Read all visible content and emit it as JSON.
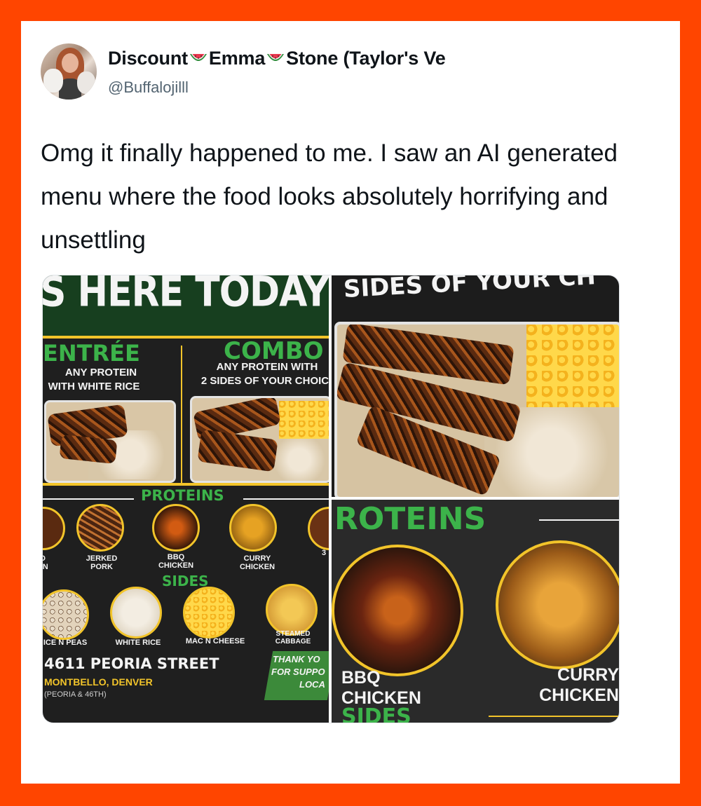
{
  "tweet": {
    "author": {
      "name_parts": [
        "Discount",
        "Emma",
        "Stone (Taylor's Ve"
      ],
      "handle": "@Buffalojilll",
      "avatar": "avatar-photo"
    },
    "text": "Omg it finally happened to me. I saw an AI generated menu where the food looks absolutely horrifying and unsettling",
    "emoji": "watermelon-icon"
  },
  "menu_image": {
    "banner": "S HERE TODAY!",
    "entree": {
      "title": "ENTRÉE",
      "line1": "ANY PROTEIN",
      "line2": "WITH WHITE RICE"
    },
    "combo": {
      "title": "COMBO",
      "line1": "ANY PROTEIN WITH",
      "line2": "2 SIDES OF YOUR CHOIC"
    },
    "proteins_title": "PROTEINS",
    "proteins": [
      "D\nEN",
      "JERKED\nPORK",
      "BBQ\nCHICKEN",
      "CURRY\nCHICKEN",
      "3"
    ],
    "sides_title": "SIDES",
    "sides": [
      "ICE N PEAS",
      "WHITE RICE",
      "MAC N CHEESE",
      "STEAMED\nCABBAGE"
    ],
    "address": "4611 PEORIA STREET",
    "city": "MONTBELLO, DENVER",
    "cross": "(PEORIA & 46TH)",
    "thanks": [
      "THANK YO",
      "FOR SUPPO",
      "LOCA"
    ],
    "top_right_header": "SIDES OF YOUR CH",
    "bottom_right_title": "ROTEINS",
    "bottom_right_labels": [
      "BBQ\nCHICKEN",
      "CURRY\nCHICKEN"
    ],
    "bottom_right_footer": "SIDES"
  },
  "colors": {
    "frame": "#ff4500",
    "card": "#ffffff",
    "menu_green": "#3cb34a",
    "menu_yellow": "#f2c42a"
  }
}
